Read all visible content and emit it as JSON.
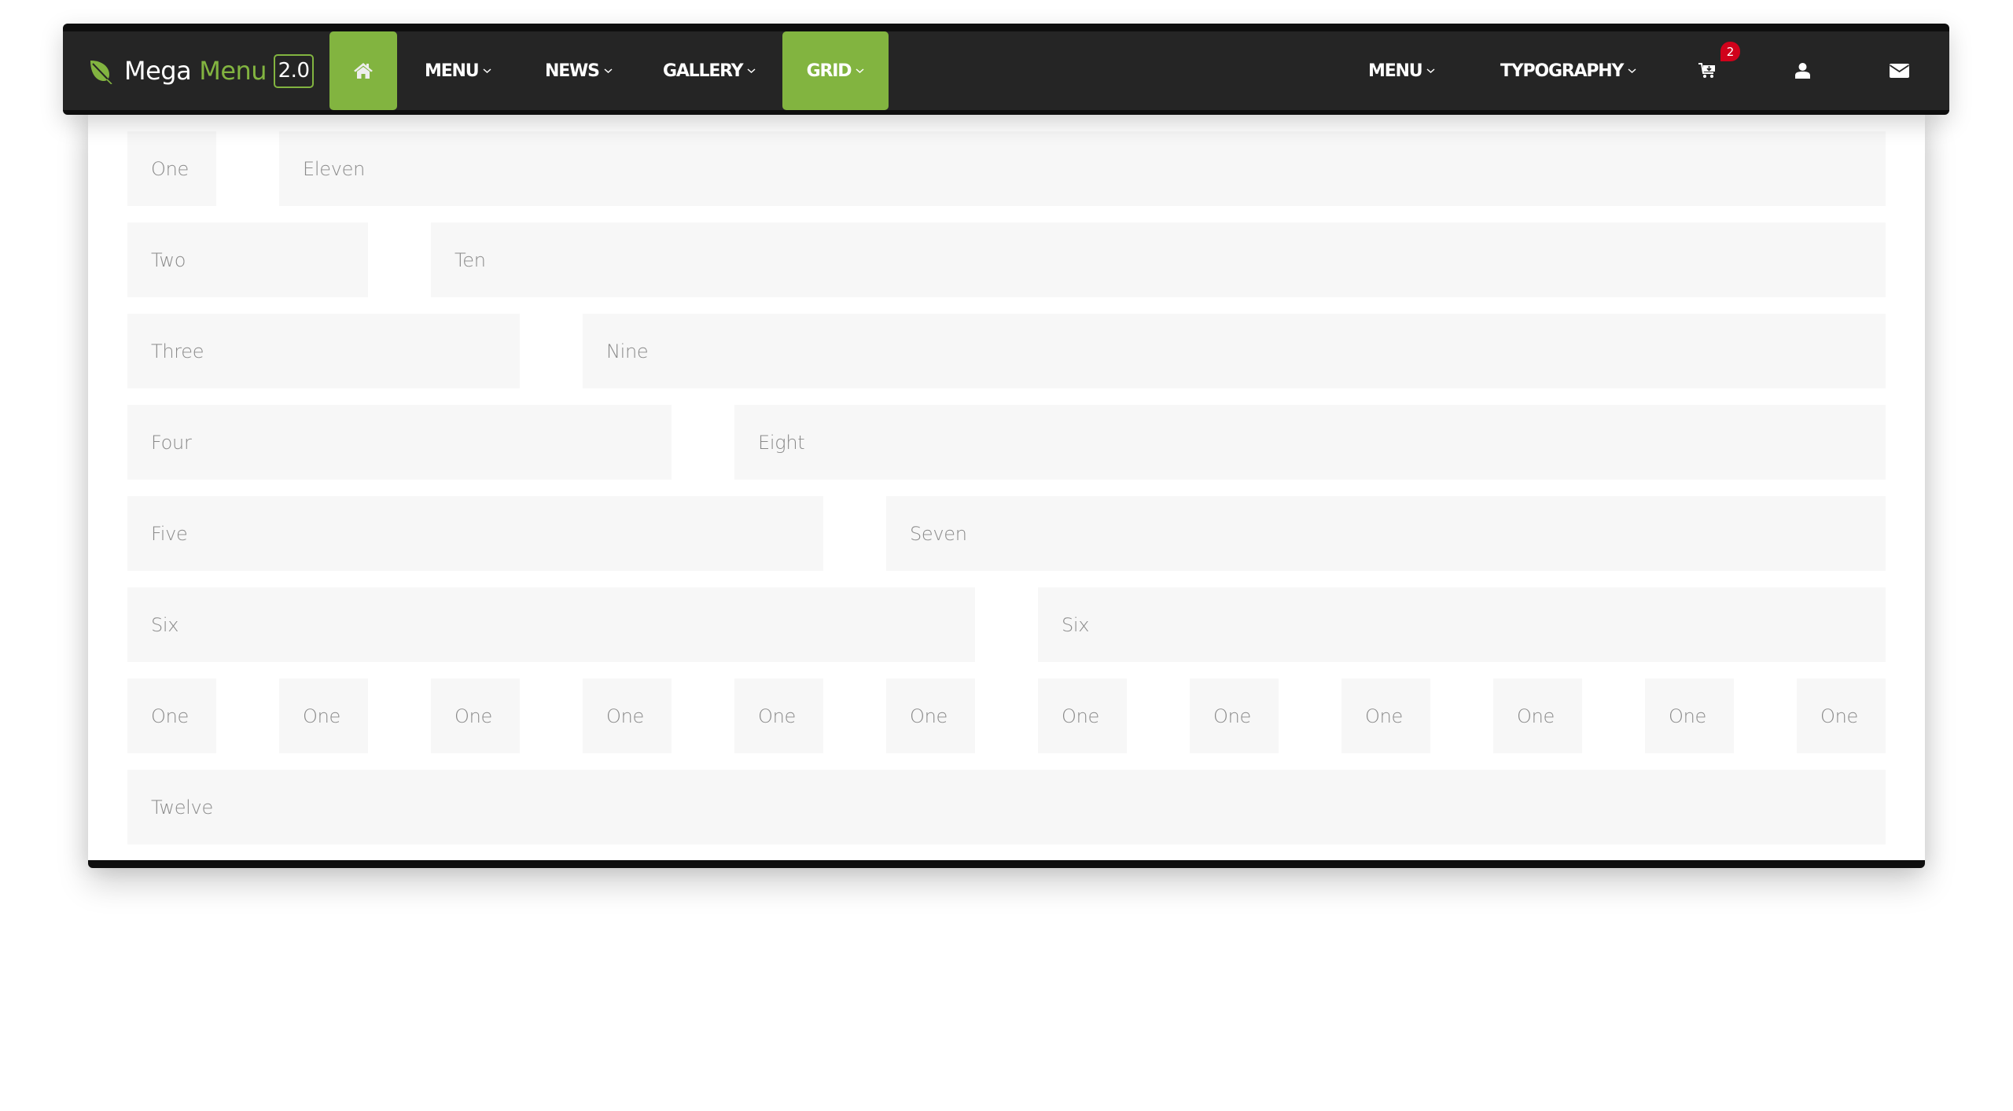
{
  "brand": {
    "name_part1": "Mega",
    "name_part2": "Menu",
    "version": "2.0",
    "icon": "leaf-icon",
    "accent_color": "#82b440"
  },
  "nav": {
    "home": {
      "icon": "home-icon",
      "active": true
    },
    "left_items": [
      {
        "label": "MENU",
        "has_dropdown": true,
        "active": false
      },
      {
        "label": "NEWS",
        "has_dropdown": true,
        "active": false
      },
      {
        "label": "GALLERY",
        "has_dropdown": true,
        "active": false
      },
      {
        "label": "GRID",
        "has_dropdown": true,
        "active": true
      }
    ],
    "right_items": [
      {
        "label": "MENU",
        "has_dropdown": true
      },
      {
        "label": "TYPOGRAPHY",
        "has_dropdown": true
      }
    ],
    "icons": [
      {
        "name": "cart-icon",
        "badge": "2"
      },
      {
        "name": "user-icon"
      },
      {
        "name": "envelope-icon"
      }
    ],
    "badge_color": "#d0021b"
  },
  "grid_panel": {
    "rows": [
      [
        {
          "label": "One",
          "span": 1
        },
        {
          "label": "Eleven",
          "span": 11
        }
      ],
      [
        {
          "label": "Two",
          "span": 2
        },
        {
          "label": "Ten",
          "span": 10
        }
      ],
      [
        {
          "label": "Three",
          "span": 3
        },
        {
          "label": "Nine",
          "span": 9
        }
      ],
      [
        {
          "label": "Four",
          "span": 4
        },
        {
          "label": "Eight",
          "span": 8
        }
      ],
      [
        {
          "label": "Five",
          "span": 5
        },
        {
          "label": "Seven",
          "span": 7
        }
      ],
      [
        {
          "label": "Six",
          "span": 6
        },
        {
          "label": "Six",
          "span": 6
        }
      ],
      [
        {
          "label": "One",
          "span": 1
        },
        {
          "label": "One",
          "span": 1
        },
        {
          "label": "One",
          "span": 1
        },
        {
          "label": "One",
          "span": 1
        },
        {
          "label": "One",
          "span": 1
        },
        {
          "label": "One",
          "span": 1
        },
        {
          "label": "One",
          "span": 1
        },
        {
          "label": "One",
          "span": 1
        },
        {
          "label": "One",
          "span": 1
        },
        {
          "label": "One",
          "span": 1
        },
        {
          "label": "One",
          "span": 1
        },
        {
          "label": "One",
          "span": 1
        }
      ],
      [
        {
          "label": "Twelve",
          "span": 12
        }
      ]
    ]
  }
}
